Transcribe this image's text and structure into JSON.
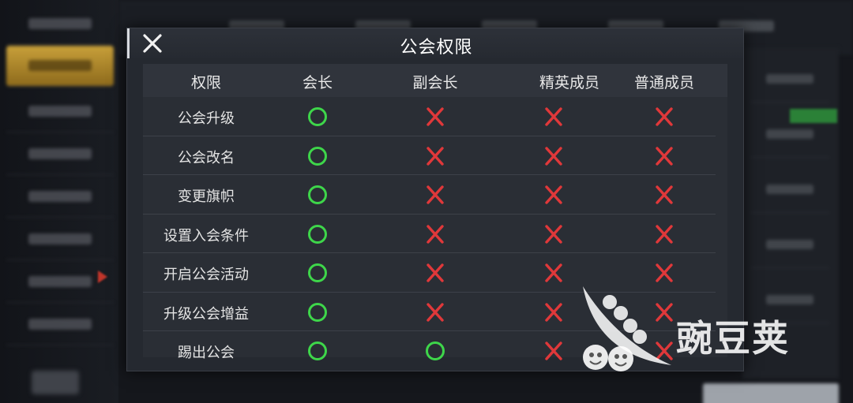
{
  "dialog": {
    "title": "公会权限",
    "close_icon": "close-icon"
  },
  "columns": [
    "权限",
    "会长",
    "副会长",
    "精英成员",
    "普通成员"
  ],
  "rows": [
    {
      "label": "公会升级",
      "values": [
        "check",
        "cross",
        "cross",
        "cross"
      ]
    },
    {
      "label": "公会改名",
      "values": [
        "check",
        "cross",
        "cross",
        "cross"
      ]
    },
    {
      "label": "变更旗帜",
      "values": [
        "check",
        "cross",
        "cross",
        "cross"
      ]
    },
    {
      "label": "设置入会条件",
      "values": [
        "check",
        "cross",
        "cross",
        "cross"
      ]
    },
    {
      "label": "开启公会活动",
      "values": [
        "check",
        "cross",
        "cross",
        "cross"
      ]
    },
    {
      "label": "升级公会增益",
      "values": [
        "check",
        "cross",
        "cross",
        "cross"
      ]
    },
    {
      "label": "踢出公会",
      "values": [
        "check",
        "check",
        "cross",
        "cross"
      ]
    }
  ],
  "colors": {
    "allowed": "#3ed64a",
    "denied": "#e0383a"
  },
  "watermark": {
    "text": "豌豆荚"
  }
}
